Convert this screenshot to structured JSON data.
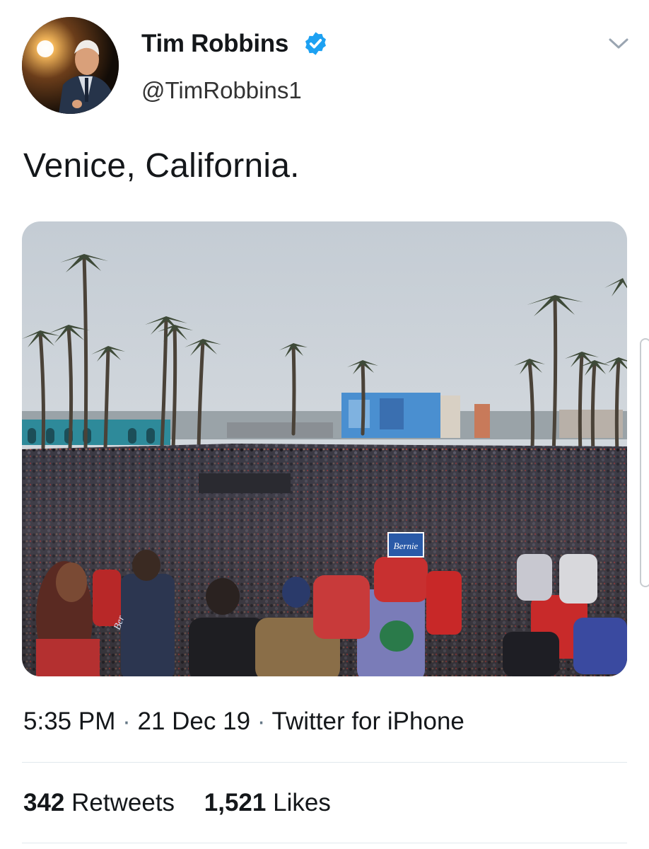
{
  "tweet": {
    "display_name": "Tim Robbins",
    "verified": true,
    "handle": "@TimRobbins1",
    "text": "Venice, California.",
    "media": {
      "sign_text": "Bernie",
      "sign_text_partial": "Ber"
    },
    "time": "5:35 PM",
    "date": "21 Dec 19",
    "source": "Twitter for iPhone",
    "separator": "·",
    "retweets_count": "342",
    "retweets_label": "Retweets",
    "likes_count": "1,521",
    "likes_label": "Likes"
  },
  "icons": {
    "verified": "verified-badge-icon",
    "caret": "chevron-down-icon"
  },
  "colors": {
    "verified_blue": "#1da1f2",
    "text": "#14171a",
    "secondary": "#657786",
    "divider": "#e1e8ed"
  }
}
